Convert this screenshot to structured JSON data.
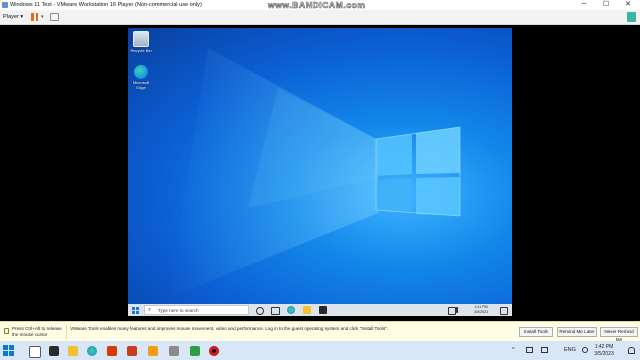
{
  "window": {
    "title": "Windows 11 Test - VMware Workstation 16 Player (Non-commercial use only)",
    "watermark": "www.BANDICAM.com",
    "minimize_glyph": "─",
    "maximize_glyph": "☐",
    "close_glyph": "✕"
  },
  "toolbar": {
    "player_menu_label": "Player ▾",
    "dropdown_glyph": "▾"
  },
  "guest": {
    "desktop_icons": [
      {
        "label": "Recycle Bin",
        "icon": "recycle-bin-icon"
      },
      {
        "label": "Microsoft Edge",
        "icon": "edge-icon"
      }
    ],
    "taskbar": {
      "search_placeholder": "Type here to search",
      "search_glyph": "⌕",
      "clock_time": "1:41 PM",
      "clock_date": "3/5/2023"
    }
  },
  "tools_bar": {
    "hint": "Press Ctrl+Alt to release the mouse cursor",
    "message": "VMware Tools enables many features and improves mouse movement, video and performance. Log in to the guest operating system and click \"Install Tools\".",
    "buttons": [
      "Install Tools",
      "Remind Me Later",
      "Never Remind Me"
    ]
  },
  "host_taskbar": {
    "tray_chevron": "^",
    "language": "ENG",
    "time": "1:42 PM",
    "date": "3/5/2023"
  },
  "colors": {
    "guest_wallpaper": "#0b5dd2",
    "vmware_pause": "#e06a1e",
    "tools_bar_bg": "#fffde4",
    "host_taskbar_bg": "#d8e6f6"
  }
}
